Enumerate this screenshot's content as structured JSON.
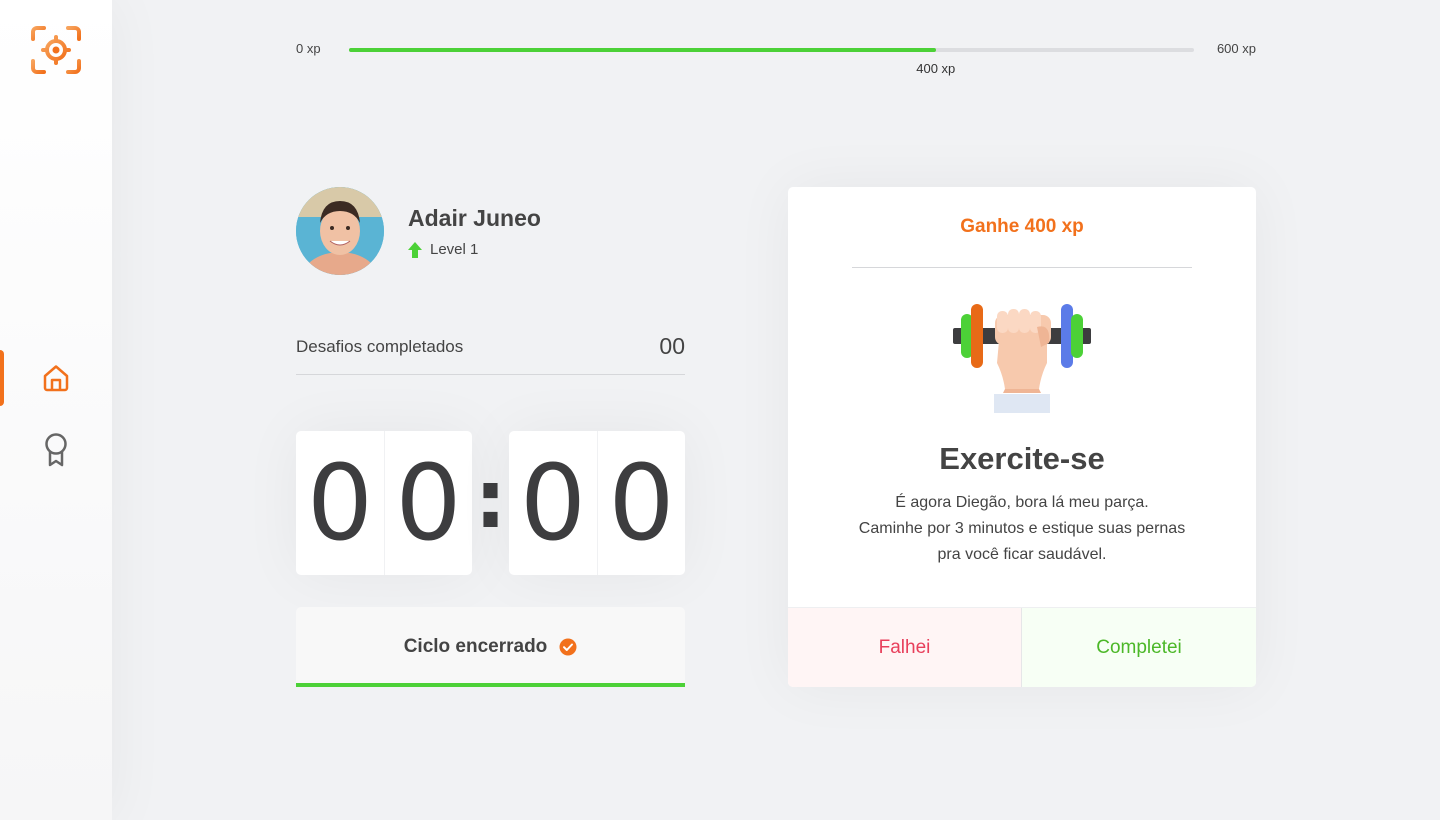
{
  "sidebar": {
    "logo_icon": "target-focus-icon",
    "items": [
      {
        "name": "home",
        "icon": "home-icon",
        "active": true
      },
      {
        "name": "leaderboard",
        "icon": "award-icon",
        "active": false
      }
    ],
    "accent_color": "#f2711c"
  },
  "xp": {
    "min_label": "0 xp",
    "max_label": "600 xp",
    "current_label": "400 xp",
    "progress": 0.6944
  },
  "profile": {
    "name": "Adair Juneo",
    "level": "Level 1"
  },
  "challenges": {
    "label": "Desafios completados",
    "count": "00"
  },
  "countdown": {
    "minutes": [
      "0",
      "0"
    ],
    "seconds": [
      "0",
      "0"
    ],
    "separator": ":"
  },
  "cycle": {
    "label": "Ciclo encerrado",
    "status_icon": "check-circle-icon",
    "progress": 1.0
  },
  "challenge_card": {
    "header": "Ganhe 400 xp",
    "icon": "dumbbell-arm-icon",
    "title": "Exercite-se",
    "description_lines": [
      "É agora Diegão, bora lá meu parça.",
      "Caminhe por 3 minutos e estique suas pernas",
      "pra você ficar saudável."
    ],
    "fail_label": "Falhei",
    "success_label": "Completei"
  },
  "colors": {
    "green": "#4cd137",
    "red": "#e83f5b",
    "orange": "#f2711c",
    "background": "#f1f2f4"
  }
}
